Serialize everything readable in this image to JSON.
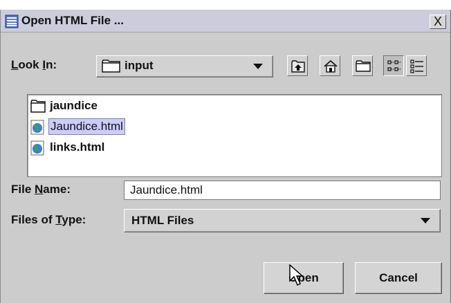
{
  "window": {
    "title": "Open HTML File ...",
    "close_label": "X"
  },
  "look_in": {
    "label": "Look In:",
    "value": "input"
  },
  "toolbar": {
    "icons": [
      "up-folder-icon",
      "home-icon",
      "new-folder-icon",
      "list-view-icon",
      "details-view-icon"
    ]
  },
  "files": [
    {
      "name": "jaundice",
      "type": "folder",
      "selected": false
    },
    {
      "name": "Jaundice.html",
      "type": "html",
      "selected": true
    },
    {
      "name": "links.html",
      "type": "html",
      "selected": false
    }
  ],
  "file_name": {
    "label": "File Name:",
    "value": "Jaundice.html"
  },
  "file_type": {
    "label": "Files of Type:",
    "value": "HTML Files"
  },
  "buttons": {
    "open": "Open",
    "cancel": "Cancel"
  },
  "colors": {
    "dialog_bg": "#cccccc",
    "titlebar_bg": "#ccccdd",
    "selection_bg": "#ccccff"
  }
}
